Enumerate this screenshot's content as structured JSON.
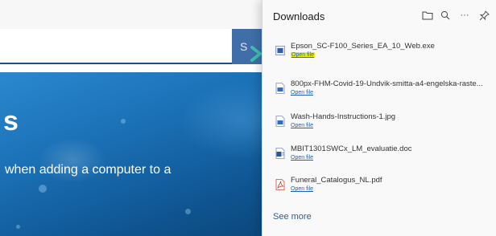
{
  "background_page": {
    "search_button_label": "S",
    "hero_title": "s",
    "hero_subtitle": "when adding a computer to a"
  },
  "downloads_panel": {
    "title": "Downloads",
    "header_icons": [
      "folder-icon",
      "search-icon",
      "more-icon",
      "pin-icon"
    ],
    "more_label": "···",
    "items": [
      {
        "name": "Epson_SC-F100_Series_EA_10_Web.exe",
        "action": "Open file",
        "icon": "exe-file-icon",
        "highlighted": true
      },
      {
        "name": "800px-FHM-Covid-19-Undvik-smitta-a4-engelska-raste...",
        "action": "Open file",
        "icon": "image-file-icon"
      },
      {
        "name": "Wash-Hands-Instructions-1.jpg",
        "action": "Open file",
        "icon": "image-file-icon"
      },
      {
        "name": "MBIT1301SWCx_LM_evaluatie.doc",
        "action": "Open file",
        "icon": "doc-file-icon"
      },
      {
        "name": "Funeral_Catalogus_NL.pdf",
        "action": "Open file",
        "icon": "pdf-file-icon"
      }
    ],
    "see_more": "See more"
  },
  "colors": {
    "link_blue": "#1a63b8",
    "highlight_yellow": "#f4f000",
    "pointer_arrow": "#3cc0b0",
    "hero_blue": "#1a6fb4"
  }
}
